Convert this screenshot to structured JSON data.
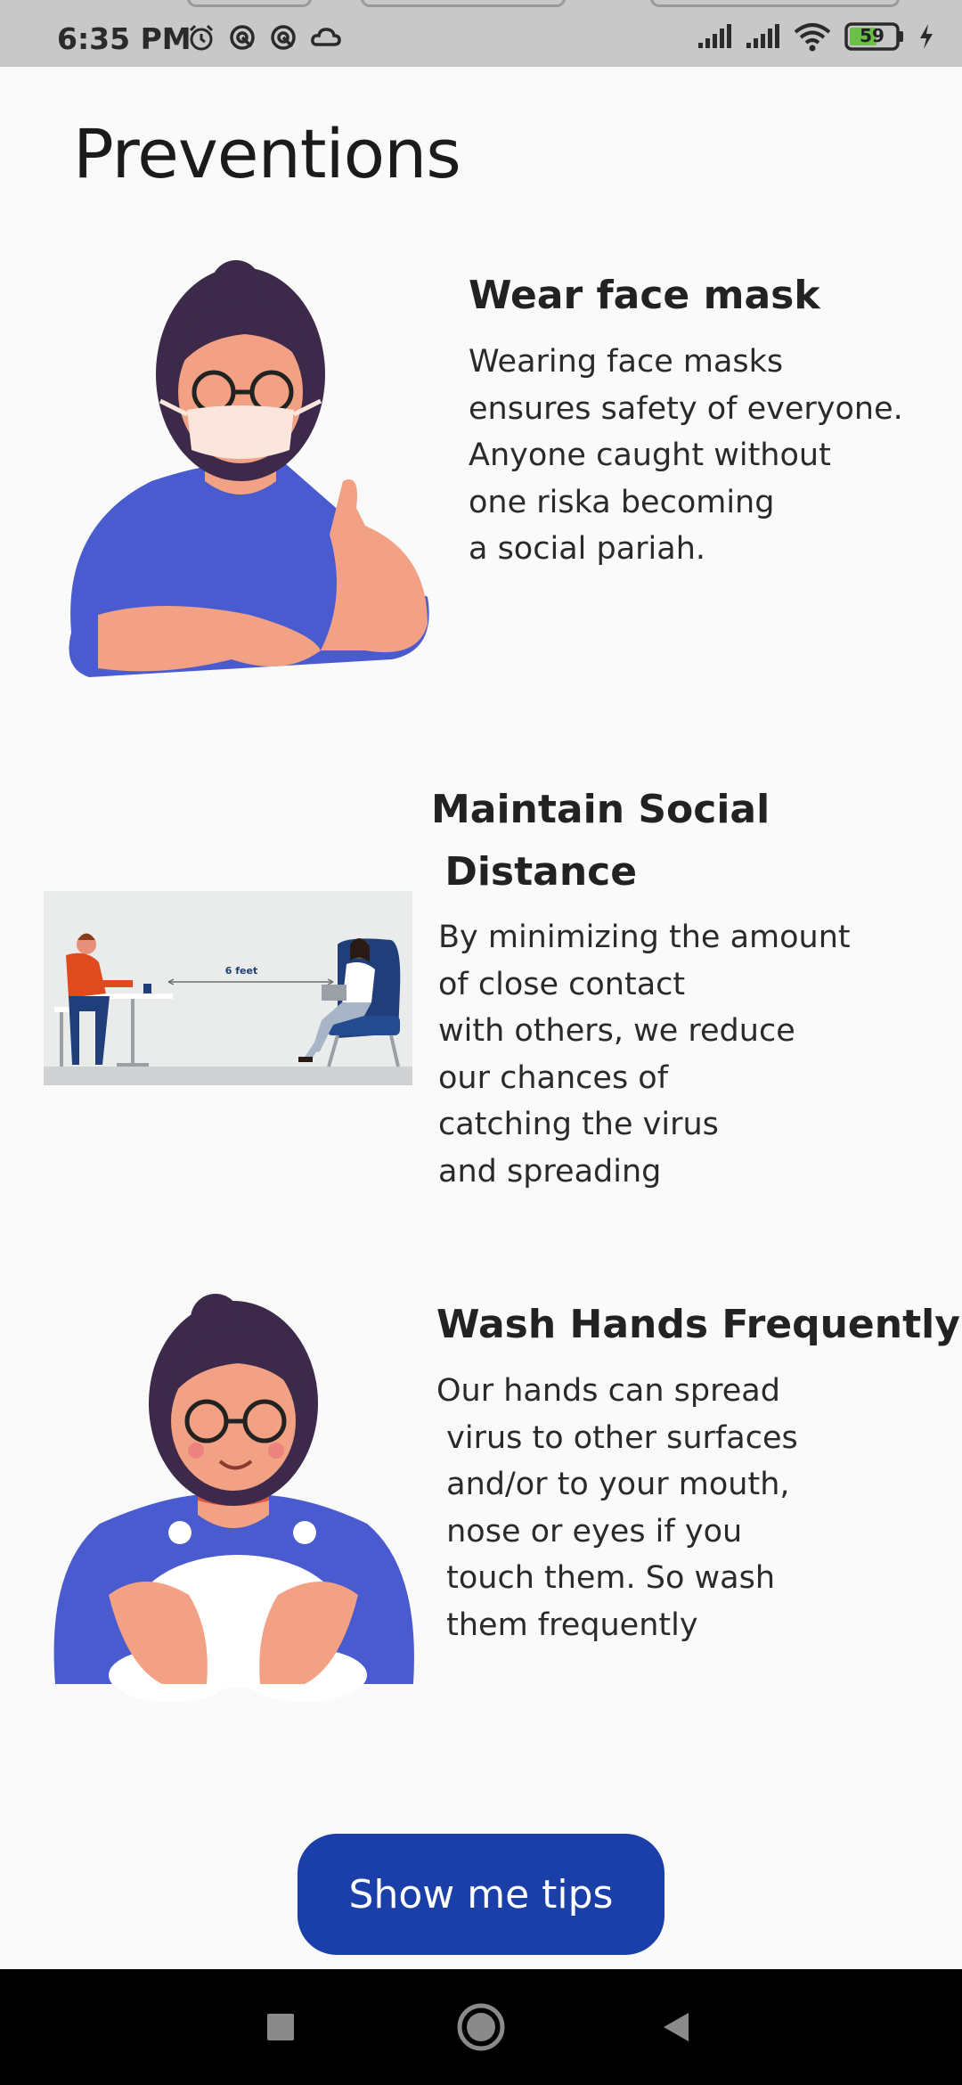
{
  "status": {
    "time": "6:35 PM",
    "battery": "59",
    "icons_left": [
      "alarm-icon",
      "sync-icon",
      "sync-icon",
      "cloud-icon"
    ],
    "icons_right": [
      "signal-icon",
      "signal-icon",
      "wifi-icon",
      "battery-icon",
      "charging-icon"
    ]
  },
  "page": {
    "title": "Preventions"
  },
  "cards": [
    {
      "title": "Wear face mask",
      "desc": "Wearing face masks\nensures safety of everyone.\nAnyone caught without\none riska becoming\na social pariah.",
      "image": "woman-with-face-mask-illustration"
    },
    {
      "title": "Maintain Social\n Distance",
      "desc": "By minimizing the amount\nof close contact\nwith others, we reduce\nour chances of\ncatching the virus\nand spreading",
      "image": "social-distance-illustration",
      "image_caption": "6 feet"
    },
    {
      "title": "Wash Hands Frequently",
      "desc": "Our hands can spread\n virus to other surfaces\n and/or to your mouth,\n nose or eyes if you\n touch them. So wash\n them frequently",
      "image": "woman-washing-hands-illustration"
    }
  ],
  "actions": {
    "tips_label": "Show me tips"
  },
  "colors": {
    "accent": "#1b3fa8",
    "shirt": "#4a5bcf",
    "skin": "#f2a184",
    "hair": "#3d2a4a"
  },
  "nav": [
    "recents-square-icon",
    "home-circle-icon",
    "back-triangle-icon"
  ]
}
